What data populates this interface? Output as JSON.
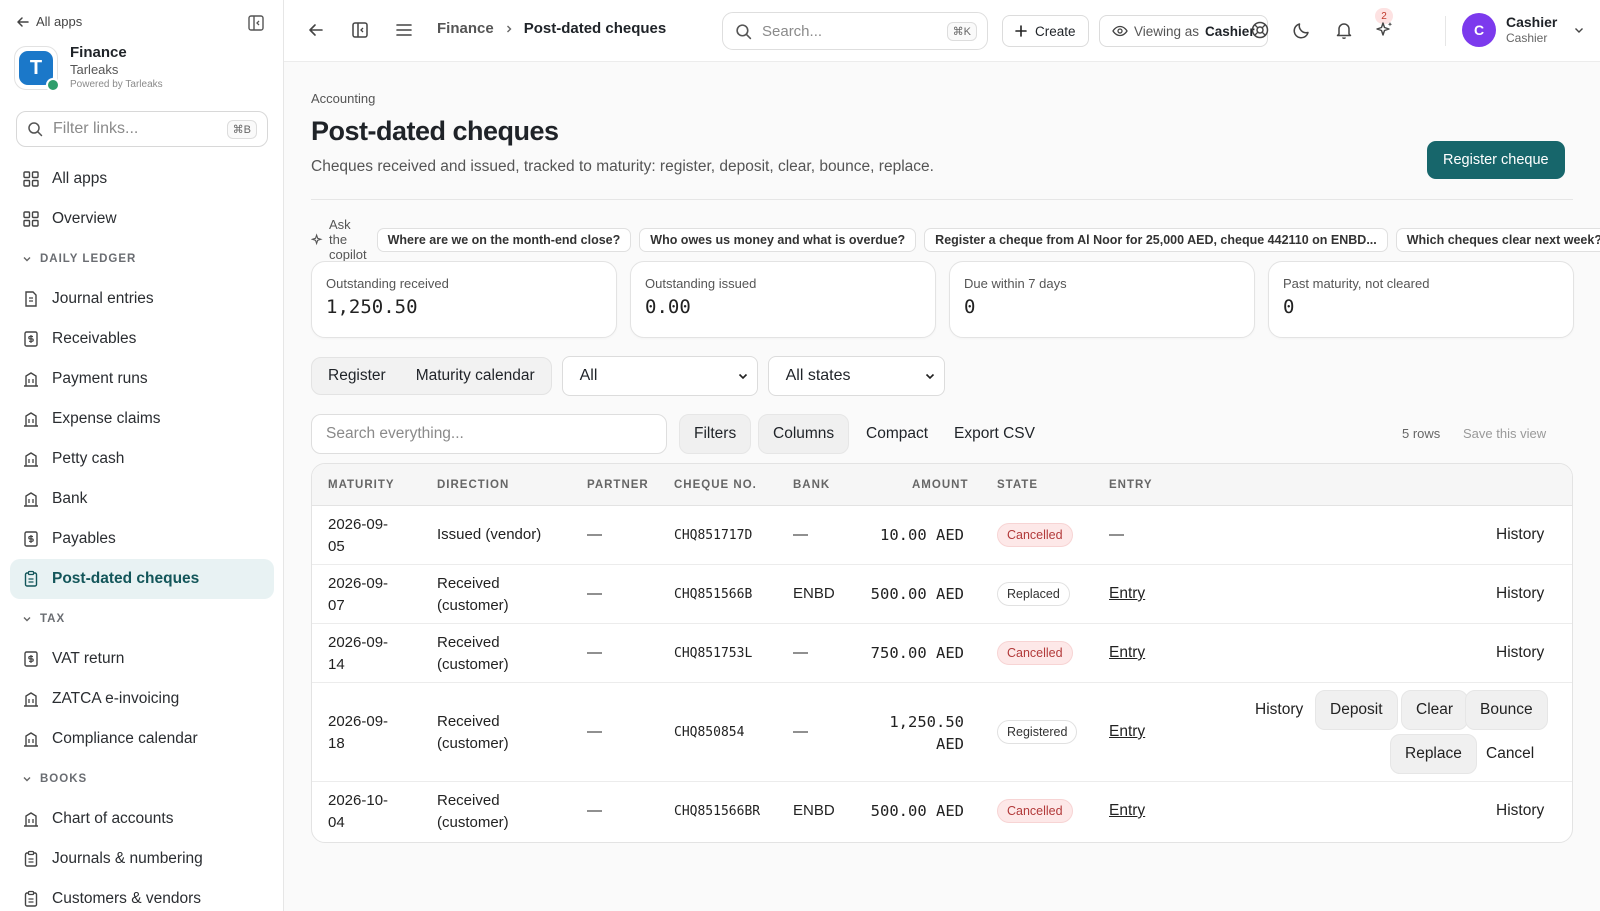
{
  "sidebar": {
    "all_apps": "All apps",
    "org_name": "Finance",
    "org_sub": "Tarleaks",
    "org_powered": "Powered by Tarleaks",
    "org_initial": "T",
    "filter_placeholder": "Filter links...",
    "filter_kbd": "⌘B",
    "items_top": [
      {
        "label": "All apps",
        "icon": "grid-icon"
      },
      {
        "label": "Overview",
        "icon": "grid-icon"
      }
    ],
    "section_daily": "DAILY LEDGER",
    "items_daily": [
      {
        "label": "Journal entries",
        "icon": "document-icon"
      },
      {
        "label": "Receivables",
        "icon": "dollar-doc-icon"
      },
      {
        "label": "Payment runs",
        "icon": "building-icon"
      },
      {
        "label": "Expense claims",
        "icon": "building-icon"
      },
      {
        "label": "Petty cash",
        "icon": "building-icon"
      },
      {
        "label": "Bank",
        "icon": "building-icon"
      },
      {
        "label": "Payables",
        "icon": "dollar-doc-icon"
      },
      {
        "label": "Post-dated cheques",
        "icon": "clipboard-icon",
        "active": true
      }
    ],
    "section_tax": "TAX",
    "items_tax": [
      {
        "label": "VAT return",
        "icon": "dollar-doc-icon"
      },
      {
        "label": "ZATCA e-invoicing",
        "icon": "building-icon"
      },
      {
        "label": "Compliance calendar",
        "icon": "building-icon"
      }
    ],
    "section_books": "BOOKS",
    "items_books": [
      {
        "label": "Chart of accounts",
        "icon": "building-icon"
      },
      {
        "label": "Journals & numbering",
        "icon": "clipboard-icon"
      },
      {
        "label": "Customers & vendors",
        "icon": "clipboard-icon"
      }
    ]
  },
  "topbar": {
    "crumb1": "Finance",
    "crumb2": "Post-dated cheques",
    "search_placeholder": "Search...",
    "search_kbd": "⌘K",
    "create": "Create",
    "viewing_prefix": "Viewing as",
    "viewing_role": "Cashier",
    "notif_count": "2",
    "user_initial": "C",
    "user_name": "Cashier",
    "user_role": "Cashier"
  },
  "page": {
    "eyebrow": "Accounting",
    "title": "Post-dated cheques",
    "description": "Cheques received and issued, tracked to maturity: register, deposit, clear, bounce, replace.",
    "primary_action": "Register cheque"
  },
  "copilot": {
    "label": "Ask the copilot",
    "chips": [
      "Where are we on the month-end close?",
      "Who owes us money and what is overdue?",
      "Register a cheque from Al Noor for 25,000 AED, cheque 442110 on ENBD...",
      "Which cheques clear next week?"
    ]
  },
  "kpis": [
    {
      "label": "Outstanding received",
      "value": "1,250.50"
    },
    {
      "label": "Outstanding issued",
      "value": "0.00"
    },
    {
      "label": "Due within 7 days",
      "value": "0"
    },
    {
      "label": "Past maturity, not cleared",
      "value": "0"
    }
  ],
  "views": {
    "register": "Register",
    "calendar": "Maturity calendar"
  },
  "filters": {
    "direction": "All",
    "state": "All states"
  },
  "toolbar": {
    "search_placeholder": "Search everything...",
    "filters": "Filters",
    "columns": "Columns",
    "compact": "Compact",
    "export": "Export CSV",
    "rows": "5 rows",
    "save_view": "Save this view"
  },
  "table": {
    "headers": [
      "MATURITY",
      "DIRECTION",
      "PARTNER",
      "CHEQUE NO.",
      "BANK",
      "AMOUNT",
      "STATE",
      "ENTRY"
    ],
    "rows": [
      {
        "maturity_a": "2026-09-",
        "maturity_b": "05",
        "direction_a": "Issued (vendor)",
        "direction_b": "",
        "partner": "—",
        "cheque": "CHQ851717D",
        "bank": "—",
        "amount_a": "10.00 AED",
        "amount_b": "",
        "state": "Cancelled",
        "entry": "—",
        "history": "History"
      },
      {
        "maturity_a": "2026-09-",
        "maturity_b": "07",
        "direction_a": "Received",
        "direction_b": "(customer)",
        "partner": "—",
        "cheque": "CHQ851566B",
        "bank": "ENBD",
        "amount_a": "500.00 AED",
        "amount_b": "",
        "state": "Replaced",
        "entry": "Entry",
        "history": "History"
      },
      {
        "maturity_a": "2026-09-",
        "maturity_b": "14",
        "direction_a": "Received",
        "direction_b": "(customer)",
        "partner": "—",
        "cheque": "CHQ851753L",
        "bank": "—",
        "amount_a": "750.00 AED",
        "amount_b": "",
        "state": "Cancelled",
        "entry": "Entry",
        "history": "History"
      },
      {
        "maturity_a": "2026-09-",
        "maturity_b": "18",
        "direction_a": "Received",
        "direction_b": "(customer)",
        "partner": "—",
        "cheque": "CHQ850854",
        "bank": "—",
        "amount_a": "1,250.50",
        "amount_b": "AED",
        "state": "Registered",
        "entry": "Entry",
        "history": "History",
        "actions": [
          "Deposit",
          "Clear",
          "Bounce",
          "Replace",
          "Cancel"
        ]
      },
      {
        "maturity_a": "2026-10-",
        "maturity_b": "04",
        "direction_a": "Received",
        "direction_b": "(customer)",
        "partner": "—",
        "cheque": "CHQ851566BR",
        "bank": "ENBD",
        "amount_a": "500.00 AED",
        "amount_b": "",
        "state": "Cancelled",
        "entry": "Entry",
        "history": "History"
      }
    ]
  },
  "colors": {
    "accent": "#17666b",
    "active_bg": "#e8f2f3",
    "cancelled": "#b23a3a",
    "avatar": "#7c3aed"
  }
}
